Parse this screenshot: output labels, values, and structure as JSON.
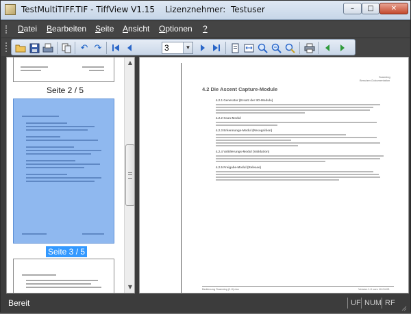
{
  "window": {
    "title": "TestMultiTIFF.TIF - TiffView V1.15    Lizenznehmer:  Testuser",
    "minimize_glyph": "–",
    "maximize_glyph": "□",
    "close_glyph": "✕"
  },
  "menu": [
    {
      "label": "Datei"
    },
    {
      "label": "Bearbeiten"
    },
    {
      "label": "Seite"
    },
    {
      "label": "Ansicht"
    },
    {
      "label": "Optionen"
    },
    {
      "label": "?"
    }
  ],
  "toolbar": {
    "page_value": "3",
    "icons": [
      "open-folder-icon",
      "save-icon",
      "scan-icon",
      "copy-icon",
      "undo-icon",
      "redo-icon",
      "first-page-icon",
      "previous-page-icon",
      "next-page-icon",
      "last-page-icon",
      "fit-page-icon",
      "fit-width-icon",
      "zoom-in-icon",
      "zoom-out-icon",
      "zoom-custom-icon",
      "print-icon",
      "back-icon",
      "forward-icon"
    ]
  },
  "thumbnails": [
    {
      "label": "Seite 2 / 5",
      "selected": false
    },
    {
      "label": "Seite 3 / 5",
      "selected": true
    },
    {
      "label": "",
      "selected": false
    }
  ],
  "document": {
    "header_line1": "Scanning",
    "header_line2": "Benutzer-Dokumentation",
    "heading": "4.2  Die Ascent Capture-Module",
    "sections": [
      {
        "title": "4.2.1    Generator (Ersatz der IIO-Module)"
      },
      {
        "title": "4.2.2    Scan-Modul"
      },
      {
        "title": "4.2.3    Erkennungs-Modul (Recognition)"
      },
      {
        "title": "4.2.4    Validierungs-Modul (Validation)"
      },
      {
        "title": "4.2.5    Freigabe-Modul (Release)"
      }
    ],
    "footer_left": "Bedienung Scanning (1.0).doc",
    "footer_right": "Version 1.0 vom 10.04.03"
  },
  "status": {
    "text": "Bereit",
    "indicators": [
      "UF",
      "NUM",
      "RF"
    ]
  }
}
